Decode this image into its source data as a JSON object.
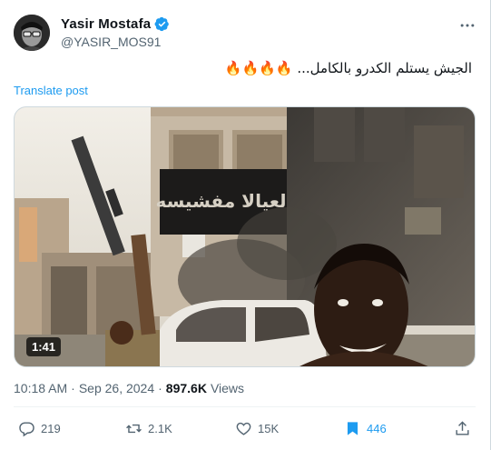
{
  "author": {
    "display_name": "Yasir Mostafa",
    "handle": "@YASIR_MOS91",
    "verified": true,
    "avatar_icon": "avatar-glasses-portrait"
  },
  "post": {
    "text": "الجيش يستلم الكدرو بالكامل... 🔥🔥🔥🔥",
    "translate_label": "Translate post"
  },
  "media": {
    "type": "video",
    "duration": "1:41",
    "sign_text": "نالعيالا مفشيسه"
  },
  "meta": {
    "time": "10:18 AM",
    "separator": "·",
    "date": "Sep 26, 2024",
    "views_count": "897.6K",
    "views_label": "Views"
  },
  "actions": {
    "replies": "219",
    "reposts": "2.1K",
    "likes": "15K",
    "bookmarks": "446"
  },
  "colors": {
    "accent": "#1d9bf0",
    "text_primary": "#0f1419",
    "text_secondary": "#536471"
  }
}
